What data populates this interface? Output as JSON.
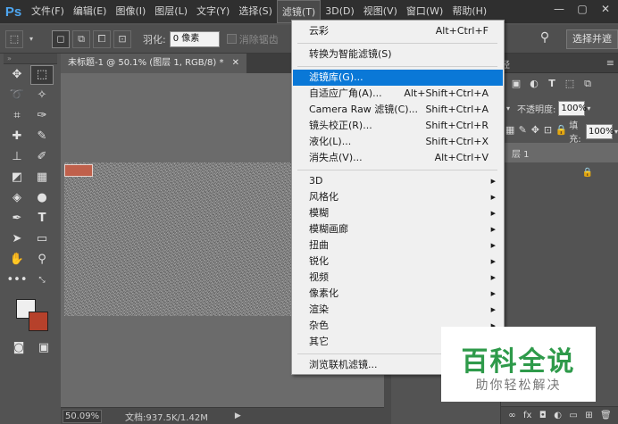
{
  "menubar": {
    "logo": "Ps",
    "items": [
      "文件(F)",
      "编辑(E)",
      "图像(I)",
      "图层(L)",
      "文字(Y)",
      "选择(S)",
      "滤镜(T)",
      "3D(D)",
      "视图(V)",
      "窗口(W)",
      "帮助(H)"
    ],
    "active_index": 6,
    "window_controls": [
      "—",
      "▢",
      "✕"
    ]
  },
  "options": {
    "feather_label": "羽化:",
    "feather_value": "0 像素",
    "antialias_label": "消除锯齿",
    "select_button": "选择并遮"
  },
  "document": {
    "tab_title": "未标题-1 @ 50.1% (图层 1, RGB/8) *",
    "close": "✕"
  },
  "status": {
    "zoom": "50.09%",
    "doc_info": "文档:937.5K/1.42M",
    "arrow": "▶"
  },
  "panel": {
    "tab_fragment": "径",
    "menu_icon": "≡",
    "opacity_label": "不透明度:",
    "opacity_value": "100%",
    "fill_label": "填充:",
    "fill_value": "100%",
    "layer_name": "层 1",
    "footer_icons": [
      "∞",
      "fx",
      "◘",
      "◐",
      "▭",
      "⊞",
      "🗑"
    ]
  },
  "filter_menu": {
    "items": [
      {
        "label": "云彩",
        "shortcut": "Alt+Ctrl+F"
      },
      {
        "label": "转换为智能滤镜(S)",
        "shortcut": ""
      },
      {
        "label": "滤镜库(G)...",
        "shortcut": "",
        "highlighted": true
      },
      {
        "label": "自适应广角(A)...",
        "shortcut": "Alt+Shift+Ctrl+A"
      },
      {
        "label": "Camera Raw 滤镜(C)...",
        "shortcut": "Shift+Ctrl+A"
      },
      {
        "label": "镜头校正(R)...",
        "shortcut": "Shift+Ctrl+R"
      },
      {
        "label": "液化(L)...",
        "shortcut": "Shift+Ctrl+X"
      },
      {
        "label": "消失点(V)...",
        "shortcut": "Alt+Ctrl+V"
      },
      {
        "label": "3D",
        "submenu": true
      },
      {
        "label": "风格化",
        "submenu": true
      },
      {
        "label": "模糊",
        "submenu": true
      },
      {
        "label": "模糊画廊",
        "submenu": true
      },
      {
        "label": "扭曲",
        "submenu": true
      },
      {
        "label": "锐化",
        "submenu": true
      },
      {
        "label": "视频",
        "submenu": true
      },
      {
        "label": "像素化",
        "submenu": true
      },
      {
        "label": "渲染",
        "submenu": true
      },
      {
        "label": "杂色",
        "submenu": true
      },
      {
        "label": "其它",
        "submenu": true
      },
      {
        "label": "浏览联机滤镜...",
        "shortcut": ""
      }
    ]
  },
  "watermark": {
    "title": "百科全说",
    "subtitle": "助你轻松解决"
  }
}
